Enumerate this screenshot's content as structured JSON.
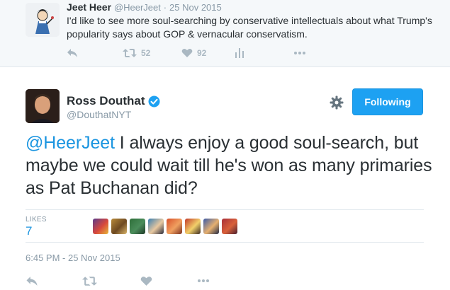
{
  "parent_tweet": {
    "name": "Jeet Heer",
    "handle": "@HeerJeet",
    "separator": "·",
    "time": "25 Nov 2015",
    "text": "I'd like to see more soul-searching by conservative intellectuals about what Trump's popularity says about GOP & vernacular conservatism.",
    "retweets": "52",
    "likes": "92",
    "icons": [
      "reply-icon",
      "retweet-icon",
      "heart-icon",
      "analytics-icon",
      "more-icon"
    ]
  },
  "main_tweet": {
    "name": "Ross Douthat",
    "handle": "@DouthatNYT",
    "follow_label": "Following",
    "mention": "@HeerJeet",
    "text": " I always enjoy a good soul-search, but maybe we could wait till he's won as many primaries as Pat Buchanan did?",
    "likes_label": "LIKES",
    "likes_count": "7",
    "timestamp": "6:45 PM - 25 Nov 2015",
    "icons": [
      "reply-icon",
      "retweet-icon",
      "heart-icon",
      "more-icon"
    ]
  },
  "colors": {
    "accent": "#1da1f2",
    "link": "#1b95e0",
    "muted": "#8899a6",
    "action_gray": "#aab8c2",
    "text": "#292f33",
    "parent_bg": "#f5f8fa",
    "divider": "#e1e8ed"
  },
  "liker_avatars": [
    {
      "name": "liker-avatar-1",
      "colors": [
        "#5a3a8c",
        "#d8483c",
        "#e6b83a"
      ]
    },
    {
      "name": "liker-avatar-2",
      "colors": [
        "#b88a3a",
        "#6e4a22",
        "#d9b56a"
      ]
    },
    {
      "name": "liker-avatar-3",
      "colors": [
        "#2f6f3a",
        "#4a8c5a",
        "#1f3a28"
      ]
    },
    {
      "name": "liker-avatar-4",
      "colors": [
        "#3a7fb0",
        "#e8c8a0",
        "#2a2a3a"
      ]
    },
    {
      "name": "liker-avatar-5",
      "colors": [
        "#d8502a",
        "#f0a060",
        "#7a3020"
      ]
    },
    {
      "name": "liker-avatar-6",
      "colors": [
        "#c23a2a",
        "#f2d06a",
        "#3a2a22"
      ]
    },
    {
      "name": "liker-avatar-7",
      "colors": [
        "#3a5aa8",
        "#e6b070",
        "#222a44"
      ]
    },
    {
      "name": "liker-avatar-8",
      "colors": [
        "#a8303a",
        "#d8603a",
        "#4a2030"
      ]
    }
  ]
}
